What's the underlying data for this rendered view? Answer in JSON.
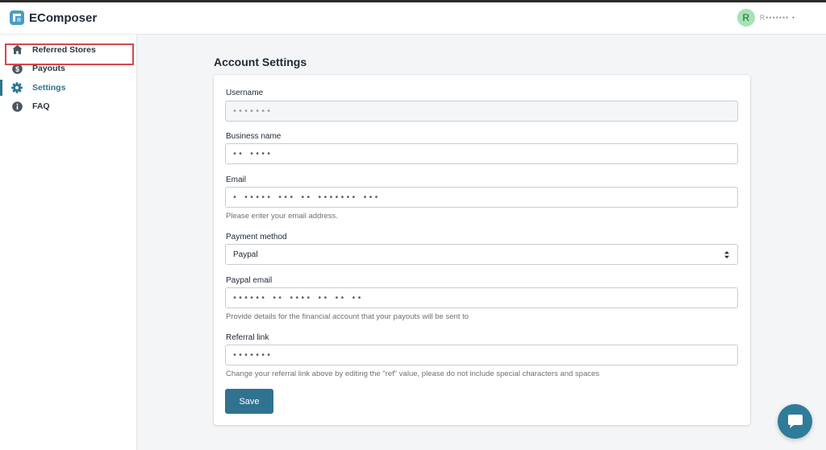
{
  "brand": {
    "name": "EComposer"
  },
  "user": {
    "initial": "R",
    "name": "R••••••• •"
  },
  "sidebar": {
    "items": [
      {
        "label": "Referred Stores",
        "icon": "home-icon"
      },
      {
        "label": "Payouts",
        "icon": "dollar-icon"
      },
      {
        "label": "Settings",
        "icon": "gear-icon",
        "active": true
      },
      {
        "label": "FAQ",
        "icon": "info-icon"
      }
    ]
  },
  "page": {
    "title": "Account Settings"
  },
  "form": {
    "username": {
      "label": "Username",
      "value": "•••••••"
    },
    "business_name": {
      "label": "Business name",
      "value": "•• ••••"
    },
    "email": {
      "label": "Email",
      "value": "• ••••• ••• •• ••••••• •••",
      "help": "Please enter your email address."
    },
    "payment_method": {
      "label": "Payment method",
      "value": "Paypal"
    },
    "paypal_email": {
      "label": "Paypal email",
      "value": "•••••• •• •••• •• •• ••",
      "help": "Provide details for the financial account that your payouts will be sent to"
    },
    "referral_link": {
      "label": "Referral link",
      "value": "•••••••",
      "help": "Change your referral link above by editing the \"ref\" value, please do not include special characters and spaces"
    },
    "save_label": "Save"
  },
  "colors": {
    "accent": "#2f7391",
    "highlight": "#d6464a",
    "avatar_bg": "#a6e3b5"
  }
}
